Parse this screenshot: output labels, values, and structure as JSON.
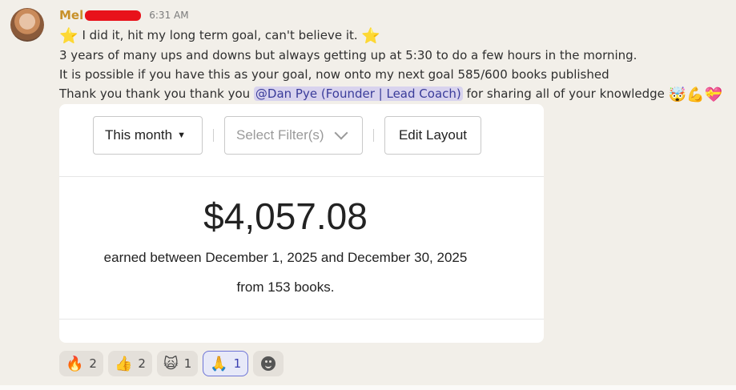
{
  "post": {
    "author": "Mel",
    "time": "6:31 AM",
    "lines": {
      "l1_text": "I did it, hit my long term goal, can't believe it.",
      "l2": "3 years of many ups and downs but always getting up at 5:30 to do a few hours in the morning.",
      "l3": "It is possible if you have this as your goal, now onto my next goal 585/600 books published",
      "l4_pre": "Thank you thank you thank you",
      "l4_mention": "@Dan Pye (Founder | Lead Coach)",
      "l4_post": "for sharing all of your knowledge"
    },
    "emojis": {
      "star": "⭐",
      "trailing": "🤯💪💝"
    }
  },
  "card": {
    "period_label": "This month",
    "filter_placeholder": "Select Filter(s)",
    "edit_layout_label": "Edit Layout",
    "amount": "$4,057.08",
    "earned_text": "earned between December 1, 2025 and December 30, 2025",
    "books_text": "from 153 books."
  },
  "reactions": [
    {
      "icon": "🔥",
      "count": "2"
    },
    {
      "icon": "👍",
      "count": "2"
    },
    {
      "icon": "🙀",
      "count": "1"
    },
    {
      "icon": "🙏",
      "count": "1"
    }
  ],
  "colors": {
    "author": "#c8912a",
    "mention_bg": "#d8d3ee",
    "mention_text": "#3a3c9a",
    "active_reaction": "#6d74d6"
  }
}
